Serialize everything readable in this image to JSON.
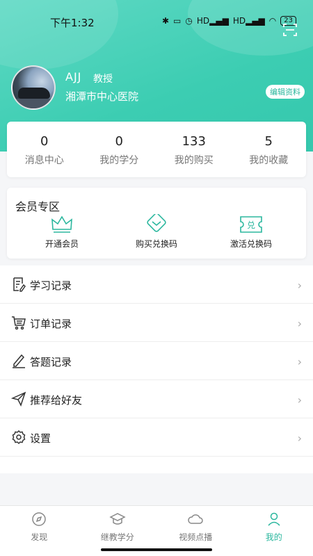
{
  "status_bar": {
    "time": "下午1:32",
    "network_1": "HD",
    "network_2": "HD",
    "battery": "23"
  },
  "profile": {
    "name": "AJJ",
    "title": "教授",
    "hospital": "湘潭市中心医院",
    "edit_label": "编辑资料"
  },
  "stats": [
    {
      "value": "0",
      "label": "消息中心"
    },
    {
      "value": "0",
      "label": "我的学分"
    },
    {
      "value": "133",
      "label": "我的购买"
    },
    {
      "value": "5",
      "label": "我的收藏"
    }
  ],
  "vip": {
    "title": "会员专区",
    "items": [
      {
        "label": "开通会员",
        "icon": "crown-icon"
      },
      {
        "label": "购买兑换码",
        "icon": "diamond-icon"
      },
      {
        "label": "激活兑换码",
        "icon": "ticket-icon",
        "icon_text": "兑"
      }
    ]
  },
  "menu": [
    {
      "label": "学习记录",
      "icon": "study-record-icon"
    },
    {
      "label": "订单记录",
      "icon": "cart-icon"
    },
    {
      "label": "答题记录",
      "icon": "pencil-icon"
    },
    {
      "label": "推荐给好友",
      "icon": "paper-plane-icon"
    },
    {
      "label": "设置",
      "icon": "gear-icon"
    }
  ],
  "tabs": [
    {
      "label": "发现",
      "icon": "compass-icon",
      "active": false
    },
    {
      "label": "继教学分",
      "icon": "graduation-cap-icon",
      "active": false
    },
    {
      "label": "视频点播",
      "icon": "cloud-icon",
      "active": false
    },
    {
      "label": "我的",
      "icon": "user-icon",
      "active": true
    }
  ],
  "colors": {
    "accent": "#2bb79e",
    "header": "#3ccdb2"
  }
}
